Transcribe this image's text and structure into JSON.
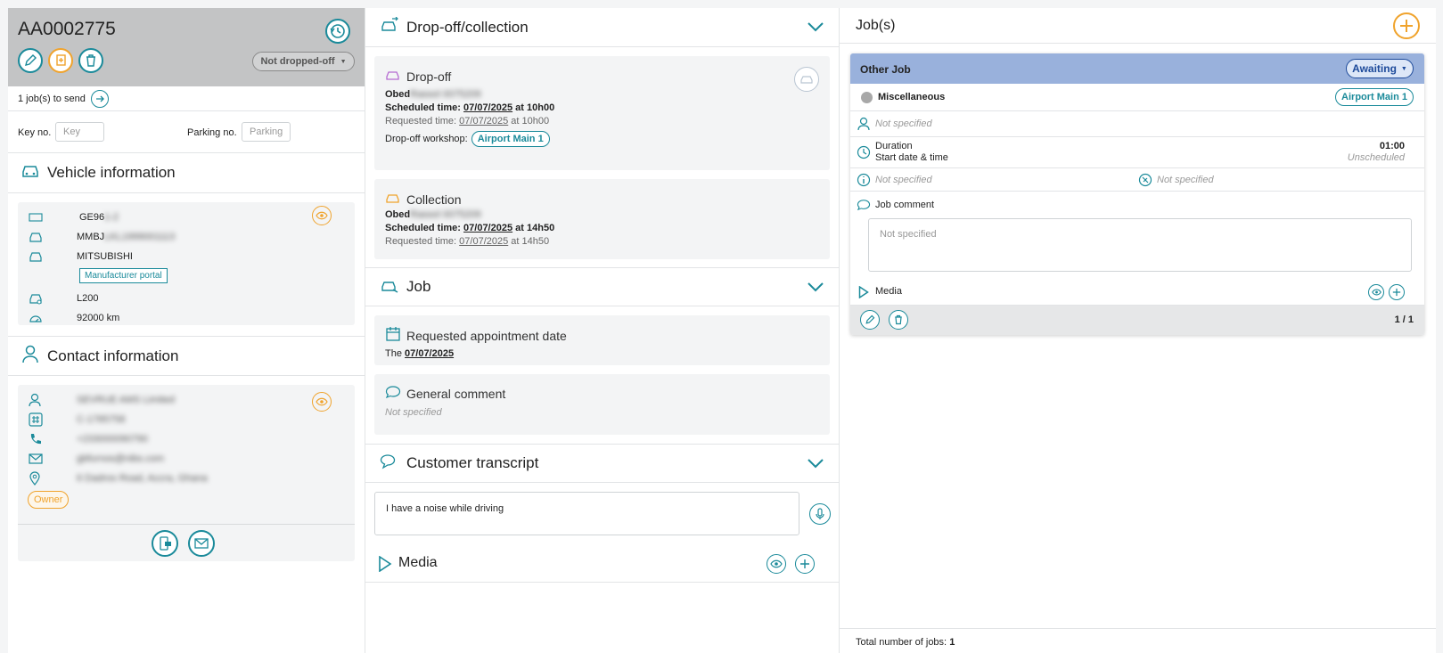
{
  "vehicle_header": {
    "reference": "AA0002775",
    "status": "Not dropped-off",
    "jobs_to_send": "1 job(s) to send",
    "key_label": "Key no.",
    "key_placeholder": "Key",
    "parking_label": "Parking no.",
    "parking_placeholder": "Parking"
  },
  "vehicle_info": {
    "title": "Vehicle information",
    "plate": "GE96",
    "plate_hidden": "1-2",
    "vin": "MMBJ",
    "vin_hidden": "LKL1999001113",
    "make": "MITSUBISHI",
    "portal_label": "Manufacturer portal",
    "model": "L200",
    "mileage": "92000 km"
  },
  "contact_info": {
    "title": "Contact information",
    "name": "SEVRUE AMS Limited",
    "id_number": "C-1785758",
    "phone": "+233000090790",
    "email": "gbfurnos@nibs.com",
    "address": "6 Dadros Road, Accra, Ghana",
    "owner_label": "Owner"
  },
  "dropoff_collection": {
    "title": "Drop-off/collection",
    "dropoff": {
      "title": "Drop-off",
      "name": "Obed",
      "name_hidden": "Rassol 0075209",
      "scheduled_label": "Scheduled time:",
      "scheduled_date": "07/07/2025",
      "scheduled_time": "at 10h00",
      "requested_label": "Requested time:",
      "requested_date": "07/07/2025",
      "requested_time": "at 10h00",
      "workshop_label": "Drop-off workshop:",
      "workshop": "Airport Main 1"
    },
    "collection": {
      "title": "Collection",
      "name": "Obed",
      "name_hidden": "Rassol 0075209",
      "scheduled_label": "Scheduled time:",
      "scheduled_date": "07/07/2025",
      "scheduled_time": "at 14h50",
      "requested_label": "Requested time:",
      "requested_date": "07/07/2025",
      "requested_time": "at 14h50"
    }
  },
  "job_section": {
    "title": "Job",
    "appointment_title": "Requested appointment date",
    "appointment_prefix": "The",
    "appointment_date": "07/07/2025",
    "comment_title": "General comment",
    "comment_value": "Not specified"
  },
  "transcript": {
    "title": "Customer transcript",
    "value": "I have a noise while driving",
    "media_label": "Media"
  },
  "jobs_panel": {
    "title": "Job(s)",
    "job": {
      "type": "Other Job",
      "status": "Awaiting",
      "category": "Miscellaneous",
      "workshop": "Airport Main 1",
      "technician": "Not specified",
      "duration_label": "Duration",
      "start_label": "Start date & time",
      "duration_value": "01:00",
      "start_value": "Unscheduled",
      "info_left": "Not specified",
      "info_right": "Not specified",
      "comment_label": "Job comment",
      "comment_placeholder": "Not specified",
      "media_label": "Media",
      "pagination": "1 / 1"
    },
    "total_label": "Total number of jobs:",
    "total_value": "1"
  },
  "colors": {
    "accent": "#1a8a9a",
    "orange": "#f0a32c",
    "job_header": "#99b1dc",
    "status_blue": "#1d4a9a"
  }
}
